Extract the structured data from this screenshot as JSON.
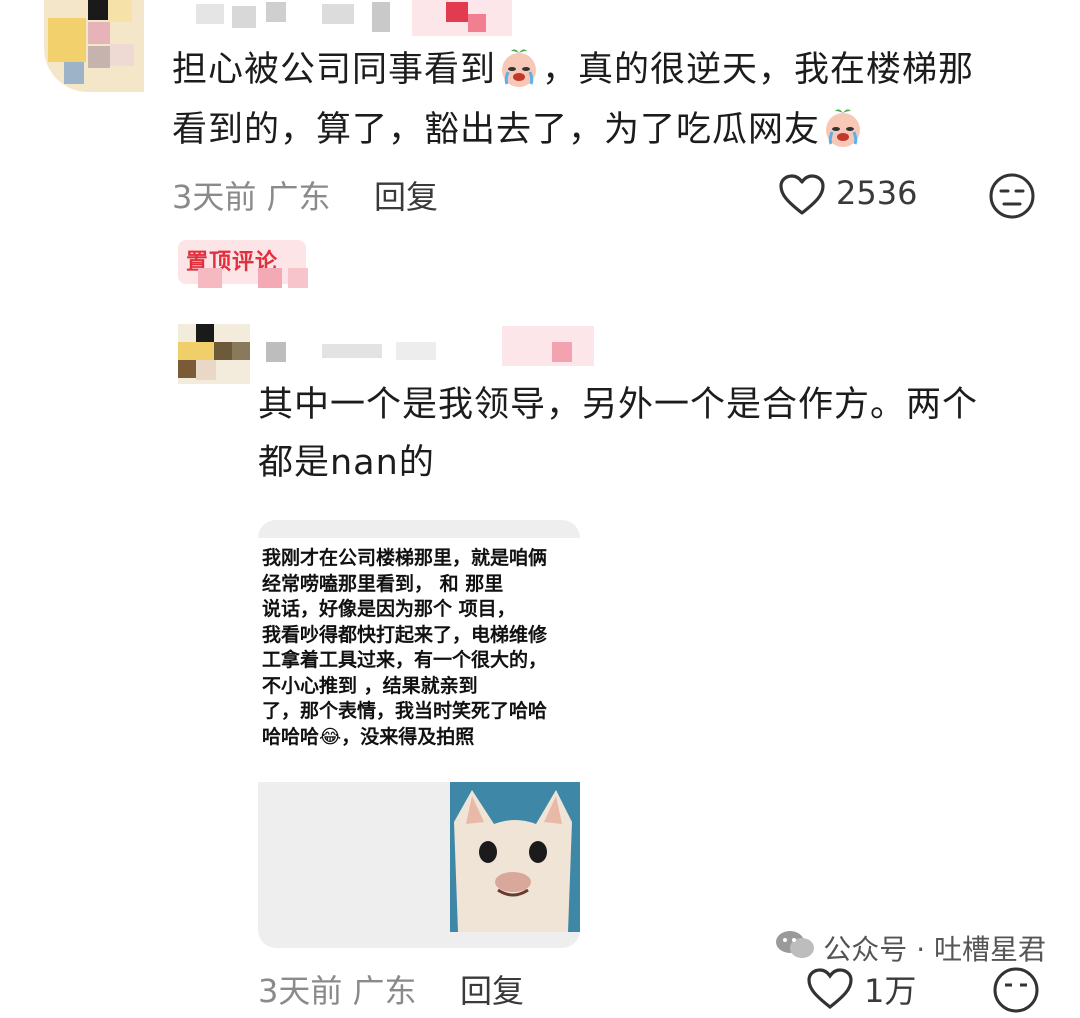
{
  "comment": {
    "text_line1": "担心被公司同事看到",
    "text_line1b": "，真的很逆天，我在楼梯那",
    "text_line2": "看到的，算了，豁出去了，为了吃瓜网友",
    "emoji": "crying-face-emoji",
    "meta": "3天前 广东",
    "reply_label": "回复",
    "likes": "2536",
    "pin_label": "置顶评论"
  },
  "reply": {
    "text_line1": "其中一个是我领导，另外一个是合作方。两个",
    "text_line2": "都是nan的",
    "card_lines": [
      "我刚才在公司楼梯那里，就是咱俩",
      "经常唠嗑那里看到，    和    那里",
      "说话，好像是因为那个      项目，",
      "我看吵得都快打起来了，电梯维修",
      "工拿着工具过来，有一个很大的，",
      "不小心推到    ，结果就亲到",
      "了，那个表情，我当时笑死了哈哈",
      "哈哈哈😂，没来得及拍照"
    ],
    "meta": "3天前 广东",
    "reply_label": "回复",
    "likes": "1万"
  },
  "watermark": "公众号 · 吐槽星君",
  "colors": {
    "accent_pin": "#e0303e",
    "meta_gray": "#8a8a8a"
  }
}
